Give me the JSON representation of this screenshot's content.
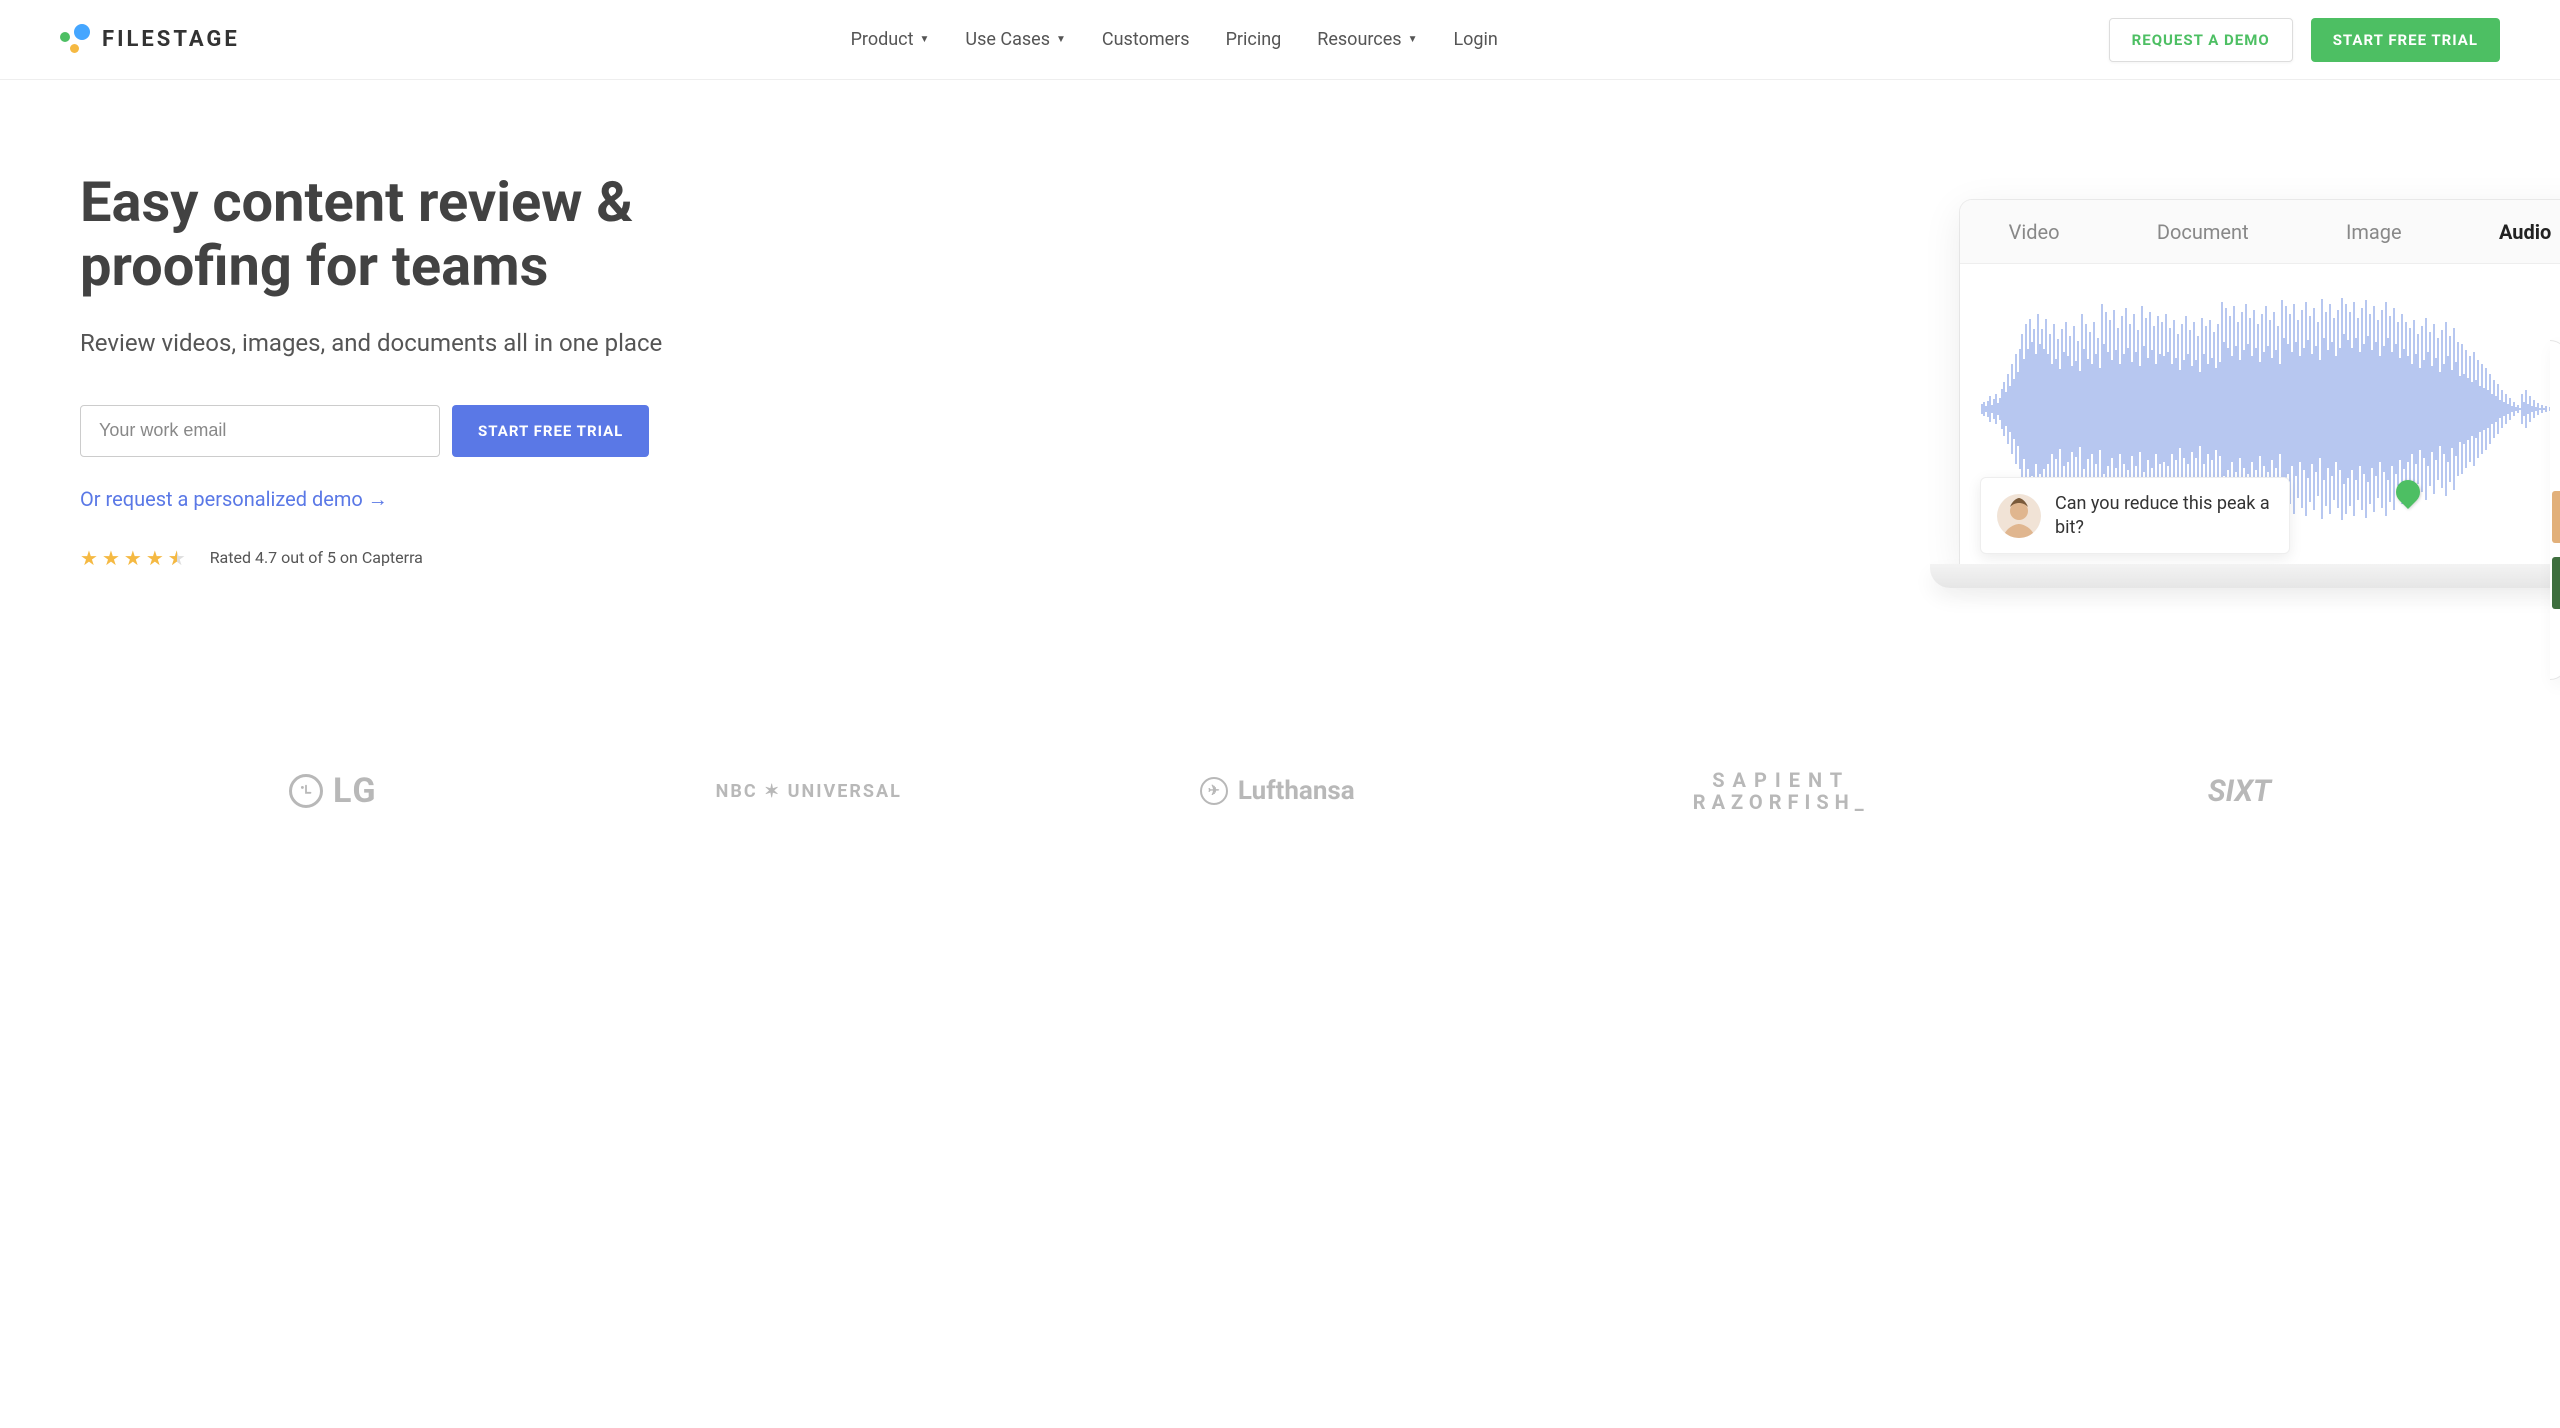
{
  "brand": {
    "name": "FILESTAGE"
  },
  "nav": {
    "items": [
      {
        "label": "Product",
        "dropdown": true
      },
      {
        "label": "Use Cases",
        "dropdown": true
      },
      {
        "label": "Customers",
        "dropdown": false
      },
      {
        "label": "Pricing",
        "dropdown": false
      },
      {
        "label": "Resources",
        "dropdown": true
      },
      {
        "label": "Login",
        "dropdown": false
      }
    ],
    "cta_demo": "REQUEST A DEMO",
    "cta_trial": "START FREE TRIAL"
  },
  "hero": {
    "title": "Easy content review & proofing for teams",
    "subtitle": "Review videos, images, and documents all in one place",
    "email_placeholder": "Your work email",
    "cta": "START FREE TRIAL",
    "demo_link": "Or request a personalized demo →",
    "rating_text": "Rated 4.7 out of 5 on Capterra",
    "rating_value": 4.7,
    "rating_max": 5
  },
  "preview": {
    "tabs": [
      {
        "label": "Video",
        "active": false
      },
      {
        "label": "Document",
        "active": false
      },
      {
        "label": "Image",
        "active": false
      },
      {
        "label": "Audio",
        "active": true
      }
    ],
    "comment": "Can you reduce this peak a bit?"
  },
  "clients": {
    "lg": "LG",
    "nbc": "NBC ✶ UNIVERSAL",
    "luft": "Lufthansa",
    "sr1": "SAPIENT",
    "sr2": "RAZORFISH_",
    "sixt": "SIXT"
  }
}
